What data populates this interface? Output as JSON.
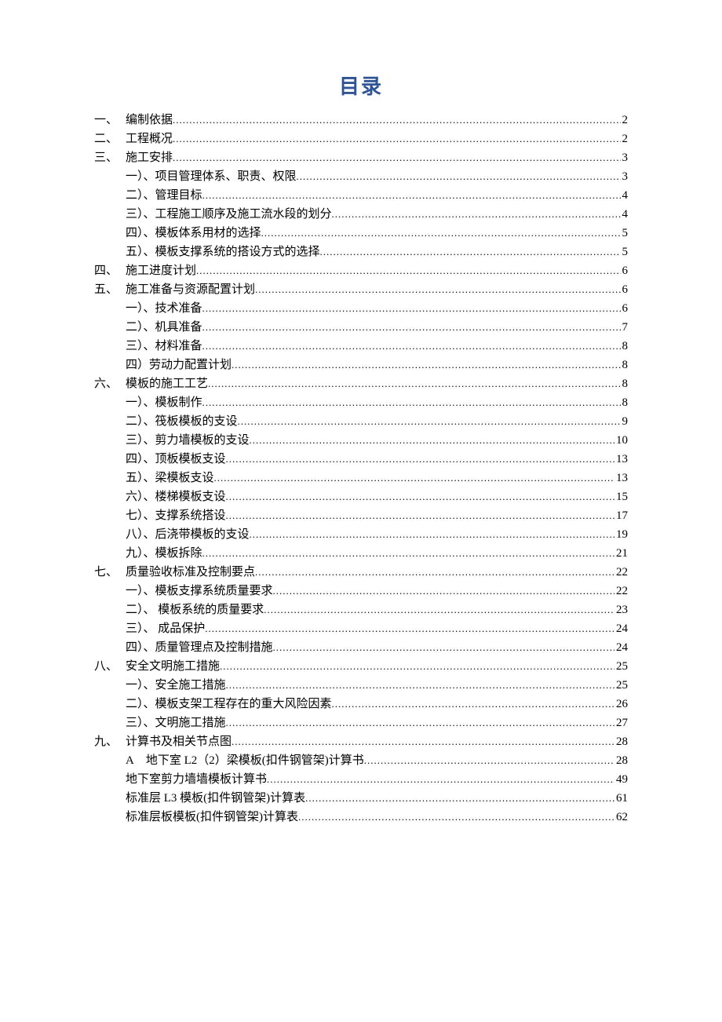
{
  "title": "目录",
  "entries": [
    {
      "level": 1,
      "num": "一、",
      "text": "编制依据",
      "page": "2"
    },
    {
      "level": 1,
      "num": "二、",
      "text": "工程概况",
      "page": "2"
    },
    {
      "level": 1,
      "num": "三、",
      "text": "施工安排",
      "page": "3"
    },
    {
      "level": 2,
      "text": "一）、项目管理体系、职责、权限",
      "page": "3"
    },
    {
      "level": 2,
      "text": "二）、管理目标",
      "page": "4"
    },
    {
      "level": 2,
      "text": "三）、工程施工顺序及施工流水段的划分",
      "page": "4"
    },
    {
      "level": 2,
      "text": "四）、模板体系用材的选择",
      "page": "5"
    },
    {
      "level": 2,
      "text": "五）、模板支撑系统的搭设方式的选择",
      "page": "5"
    },
    {
      "level": 1,
      "num": "四、",
      "text": "施工进度计划",
      "page": "6"
    },
    {
      "level": 1,
      "num": "五、",
      "text": "施工准备与资源配置计划",
      "page": "6"
    },
    {
      "level": 2,
      "text": "一）、技术准备",
      "page": "6"
    },
    {
      "level": 2,
      "text": "二）、机具准备",
      "page": "7"
    },
    {
      "level": 2,
      "text": "三）、材料准备",
      "page": "8"
    },
    {
      "level": 2,
      "text": "四）劳动力配置计划",
      "page": "8"
    },
    {
      "level": 1,
      "num": "六、",
      "text": "模板的施工工艺",
      "page": "8"
    },
    {
      "level": 2,
      "text": "一）、模板制作",
      "page": "8"
    },
    {
      "level": 2,
      "text": "二）、筏板模板的支设",
      "page": "9"
    },
    {
      "level": 2,
      "text": "三）、剪力墙模板的支设",
      "page": "10"
    },
    {
      "level": 2,
      "text": "四）、顶板模板支设",
      "page": "13"
    },
    {
      "level": 2,
      "text": "五）、梁模板支设",
      "page": "13"
    },
    {
      "level": 2,
      "text": "六）、楼梯模板支设",
      "page": "15"
    },
    {
      "level": 2,
      "text": "七）、支撑系统搭设",
      "page": "17"
    },
    {
      "level": 2,
      "text": "八）、后浇带模板的支设",
      "page": "19"
    },
    {
      "level": 2,
      "text": "九）、模板拆除",
      "page": "21"
    },
    {
      "level": 1,
      "num": "七、",
      "text": "质量验收标准及控制要点",
      "page": "22"
    },
    {
      "level": 2,
      "text": "一）、模板支撑系统质量要求",
      "page": "22"
    },
    {
      "level": 2,
      "text": "二）、 模板系统的质量要求",
      "page": "23"
    },
    {
      "level": 2,
      "text": "三）、 成品保护",
      "page": "24"
    },
    {
      "level": 2,
      "text": "四）、质量管理点及控制措施",
      "page": "24"
    },
    {
      "level": 1,
      "num": "八、",
      "text": "安全文明施工措施",
      "page": "25"
    },
    {
      "level": 2,
      "text": "一）、安全施工措施",
      "page": "25"
    },
    {
      "level": 2,
      "text": "二）、模板支架工程存在的重大风险因素",
      "page": "26"
    },
    {
      "level": 2,
      "text": "三）、文明施工措施",
      "page": "27"
    },
    {
      "level": 1,
      "num": "九、",
      "text": "计算书及相关节点图",
      "page": "28"
    },
    {
      "level": 2,
      "text": "A 地下室 L2（2）梁模板(扣件钢管架)计算书",
      "page": "28"
    },
    {
      "level": 2,
      "text": "地下室剪力墙墙模板计算书",
      "page": "49"
    },
    {
      "level": 2,
      "text": "标准层 L3 模板(扣件钢管架)计算表",
      "page": "61"
    },
    {
      "level": 2,
      "text": "标准层板模板(扣件钢管架)计算表",
      "page": "62"
    }
  ]
}
